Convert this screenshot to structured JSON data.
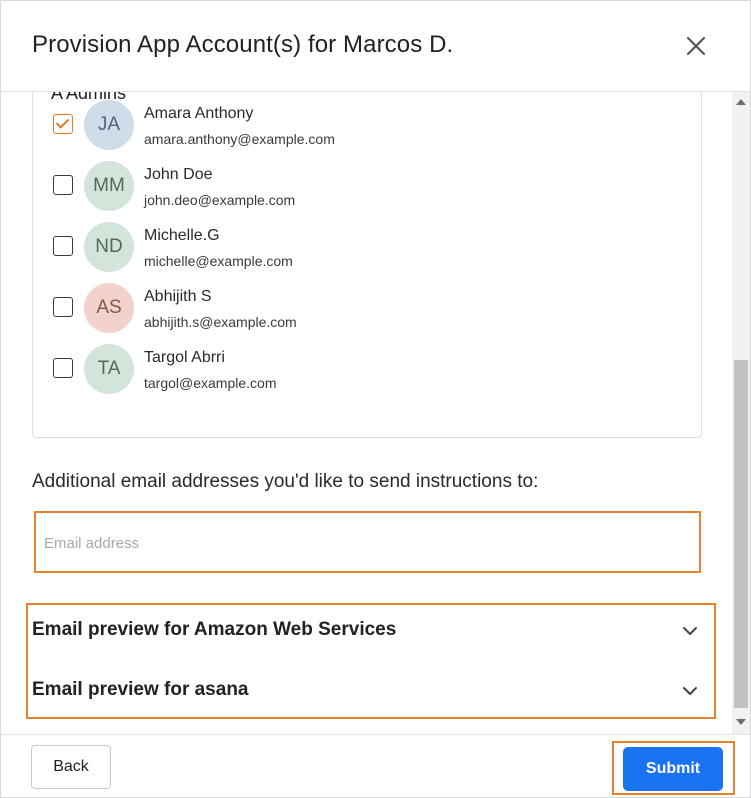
{
  "dialog": {
    "title": "Provision App Account(s) for Marcos D.",
    "close_icon": "close-icon"
  },
  "users_panel": {
    "heading": "A Admins",
    "users": [
      {
        "initials": "JA",
        "name": "Amara Anthony",
        "email": "amara.anthony@example.com",
        "checked": true,
        "avatar_color": "#cfdcea",
        "initials_color": "#4f6680"
      },
      {
        "initials": "MM",
        "name": "John Doe",
        "email": "john.deo@example.com",
        "checked": false,
        "avatar_color": "#d3e4da",
        "initials_color": "#4f6b5a"
      },
      {
        "initials": "ND",
        "name": "Michelle.G",
        "email": "michelle@example.com",
        "checked": false,
        "avatar_color": "#d3e4da",
        "initials_color": "#4f6b5a"
      },
      {
        "initials": "AS",
        "name": "Abhijith S",
        "email": "abhijith.s@example.com",
        "checked": false,
        "avatar_color": "#f2d2cb",
        "initials_color": "#85564b"
      },
      {
        "initials": "TA",
        "name": "Targol Abrri",
        "email": "targol@example.com",
        "checked": false,
        "avatar_color": "#d3e4da",
        "initials_color": "#4f6b5a"
      }
    ]
  },
  "additional": {
    "label": "Additional email addresses you'd like to send instructions to:",
    "placeholder": "Email address",
    "value": ""
  },
  "previews": [
    {
      "label": "Email preview for Amazon Web Services",
      "icon": "chevron-down-icon"
    },
    {
      "label": "Email preview for asana",
      "icon": "chevron-down-icon"
    }
  ],
  "footer": {
    "back_label": "Back",
    "submit_label": "Submit"
  },
  "colors": {
    "accent_outline": "#e8812f",
    "primary_button": "#1a73f0",
    "checkbox_checked": "#e07a2c"
  }
}
